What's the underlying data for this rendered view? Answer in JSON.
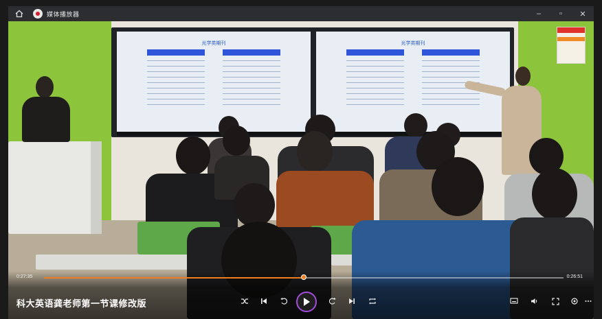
{
  "titlebar": {
    "app_title": "媒体播放器"
  },
  "player": {
    "current_time": "0:27:35",
    "total_time": "0:26:51",
    "progress_fraction": 0.5,
    "video_title": "科大英语龚老师第一节课修改版",
    "accent_color": "#f07d1e",
    "play_ring_color": "#a44ce0"
  },
  "scene": {
    "slide_title": "光学类期刊"
  },
  "icons": {
    "home": "home-icon",
    "logo": "app-logo-icon",
    "minimize": "minimize-icon",
    "maximize": "maximize-icon",
    "close": "close-icon",
    "shuffle": "shuffle-icon",
    "previous": "previous-icon",
    "rewind": "rewind-icon",
    "play": "play-icon",
    "forward": "forward-icon",
    "next": "next-icon",
    "repeat": "repeat-icon",
    "subtitle": "subtitle-icon",
    "volume": "volume-icon",
    "fullscreen": "fullscreen-icon",
    "settings": "settings-icon",
    "more": "more-icon"
  }
}
